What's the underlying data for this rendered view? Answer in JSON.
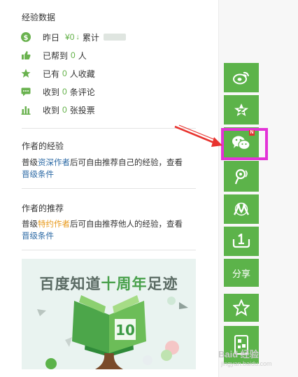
{
  "experience_data": {
    "title": "经验数据",
    "yesterday_label": "昨日",
    "yesterday_value": "¥0",
    "cumulative_label": "累计",
    "helped_prefix": "已帮到",
    "helped_count": "0",
    "helped_suffix": "人",
    "favorites_prefix": "已有",
    "favorites_count": "0",
    "favorites_suffix": "人收藏",
    "comments_prefix": "收到",
    "comments_count": "0",
    "comments_suffix": "条评论",
    "votes_prefix": "收到",
    "votes_count": "0",
    "votes_suffix": "张投票"
  },
  "author_experience": {
    "title": "作者的经验",
    "text_1": "普级",
    "link_1": "资深作者",
    "text_2": "后可自由推荐自己的经验，查看",
    "link_2": "晋级条件"
  },
  "author_recommend": {
    "title": "作者的推荐",
    "text_1": "普级",
    "link_1": "特约作者",
    "text_2": "后可自由推荐他人的经验，查看",
    "link_2": "晋级条件"
  },
  "banner": {
    "title_part1": "百度知道",
    "title_part2": "十周年",
    "title_part3": "足迹",
    "book_number": "10"
  },
  "share_bar": {
    "share_label": "分享",
    "new_badge": "N",
    "accent_color": "#5cb34a",
    "highlight_color": "#e333d7"
  },
  "watermark": {
    "text": "Baid 经验",
    "sub": "jingyan.baidu.com"
  }
}
